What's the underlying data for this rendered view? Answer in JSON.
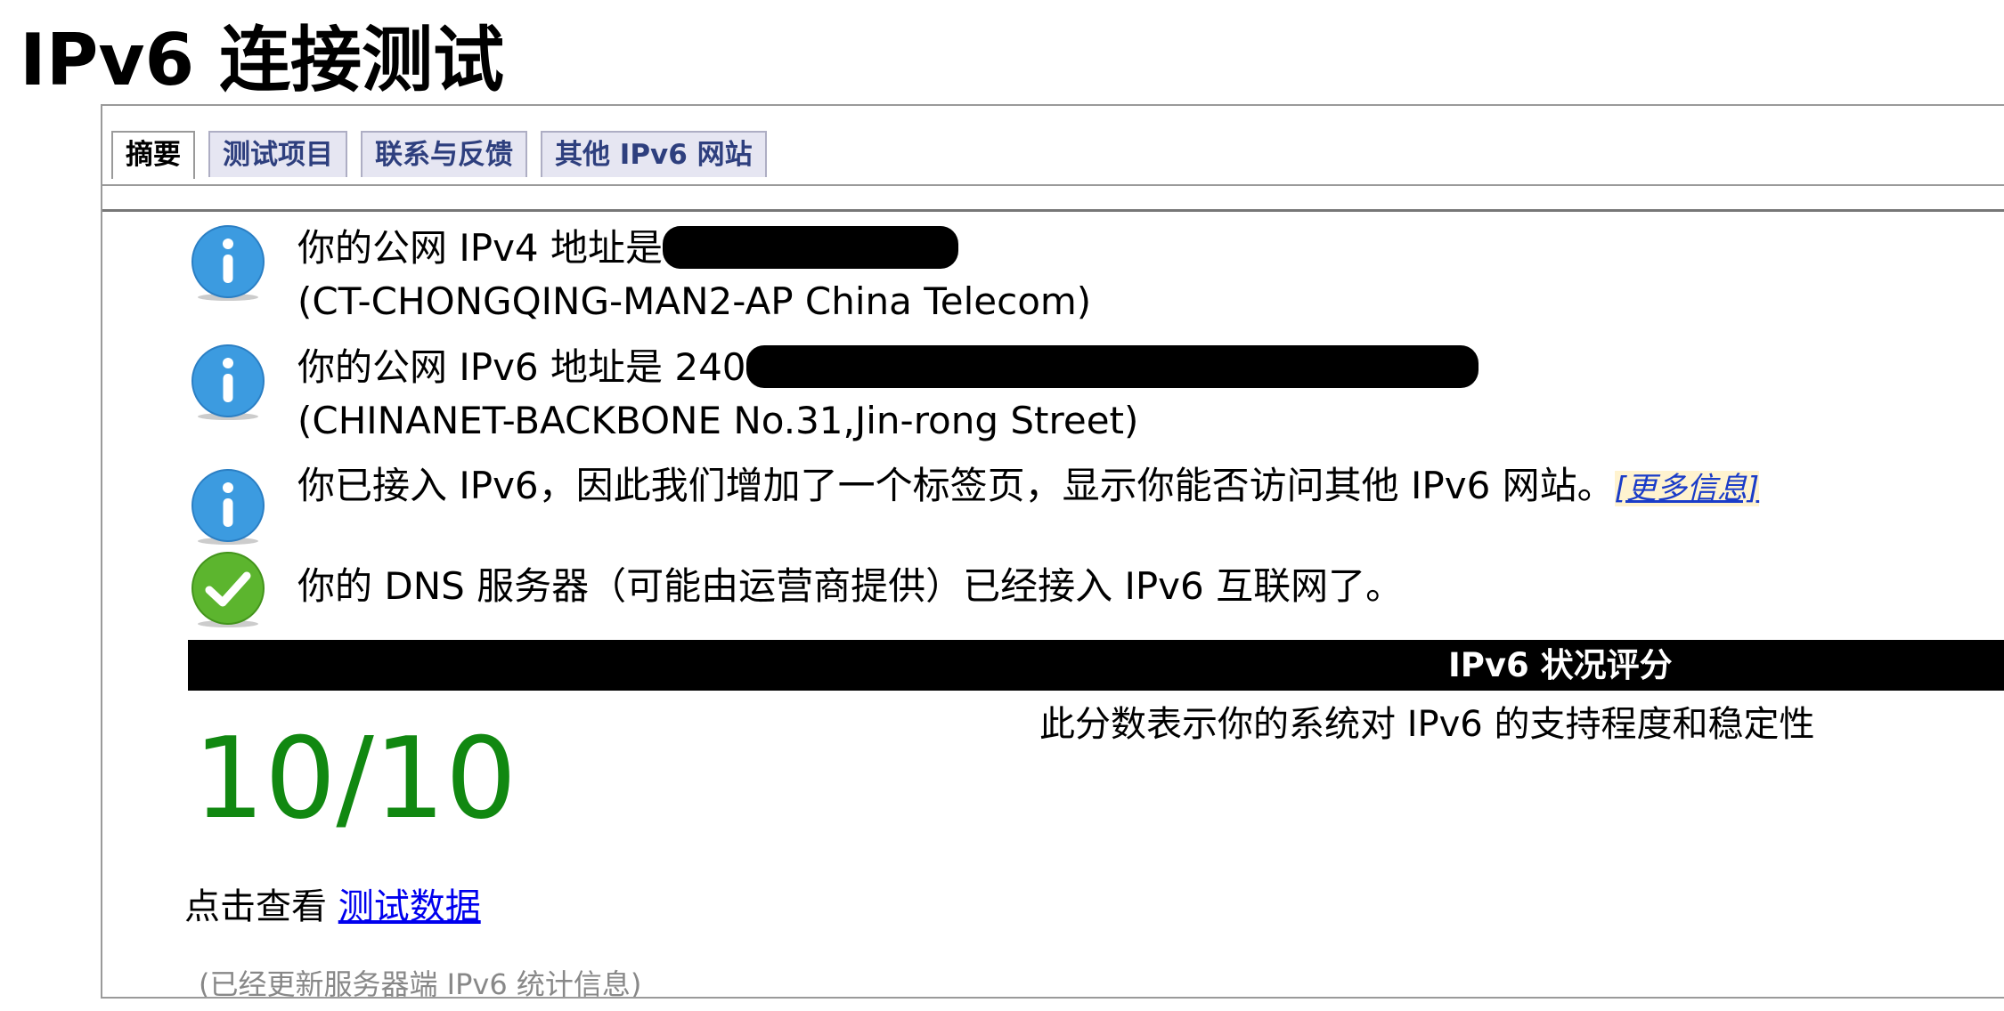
{
  "page": {
    "title": "IPv6 连接测试"
  },
  "tabs": [
    {
      "label": "摘要",
      "active": true
    },
    {
      "label": "测试项目",
      "active": false
    },
    {
      "label": "联系与反馈",
      "active": false
    },
    {
      "label": "其他 IPv6 网站",
      "active": false
    }
  ],
  "messages": {
    "ipv4": {
      "icon": "info-icon",
      "line1_prefix": "你的公网 IPv4 地址是",
      "line2": "(CT-CHONGQING-MAN2-AP China Telecom)"
    },
    "ipv6": {
      "icon": "info-icon",
      "line1_prefix": "你的公网 IPv6 地址是 240",
      "line2": "(CHINANET-BACKBONE No.31,Jin-rong Street)"
    },
    "tab_added": {
      "icon": "info-icon",
      "text": "你已接入 IPv6，因此我们增加了一个标签页，显示你能否访问其他 IPv6 网站。",
      "link": "[更多信息]"
    },
    "dns": {
      "icon": "check-icon",
      "text": "你的 DNS 服务器（可能由运营商提供）已经接入 IPv6 互联网了。"
    }
  },
  "score": {
    "header": "IPv6 状况评分",
    "description": "此分数表示你的系统对 IPv6 的支持程度和稳定性",
    "value": "10/10",
    "value_color": "#118811"
  },
  "details": {
    "prefix": "点击查看 ",
    "link": "测试数据"
  },
  "footnote": "(已经更新服务器端 IPv6 统计信息)",
  "colors": {
    "info_blue": "#3c9be0",
    "success_green": "#5cb52e",
    "tab_text": "#2e3f7e",
    "tab_bg": "#e6e6f2",
    "link_blue": "#0000ee"
  }
}
